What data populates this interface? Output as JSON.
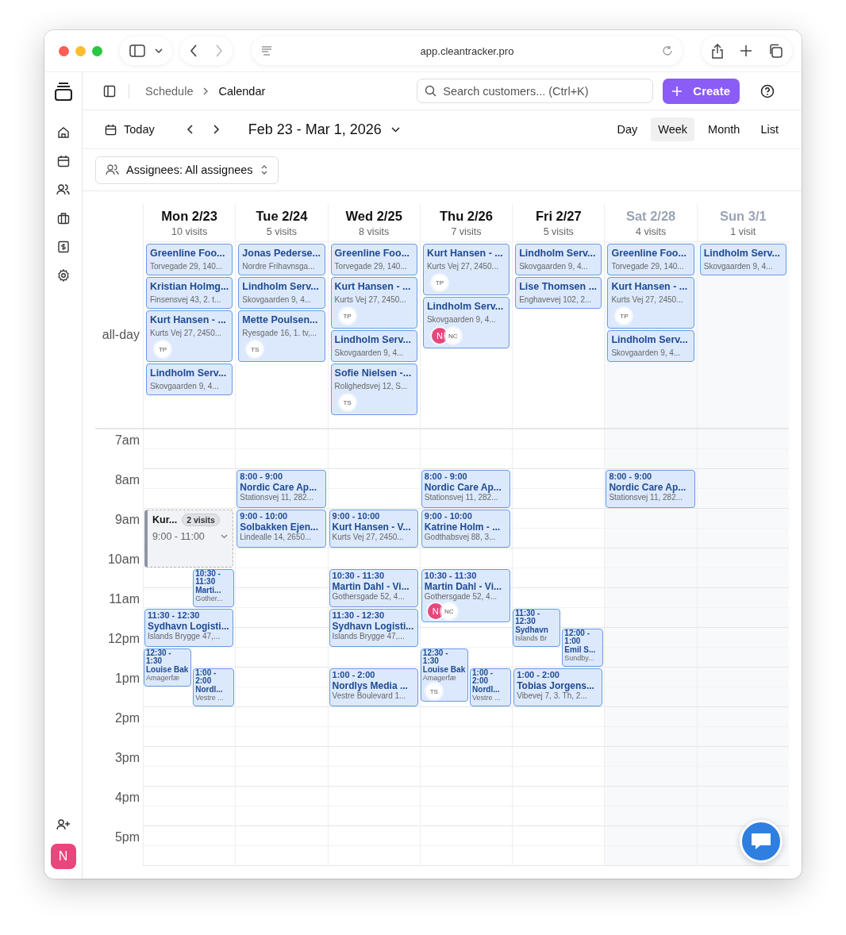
{
  "browser": {
    "url": "app.cleantracker.pro"
  },
  "sidebar": {
    "avatar": "N"
  },
  "header": {
    "breadcrumbs": [
      "Schedule",
      "Calendar"
    ],
    "search": {
      "placeholder": "Search customers... (Ctrl+K)"
    },
    "create_button": "Create"
  },
  "toolbar": {
    "today": "Today",
    "range": "Feb 23 - Mar 1, 2026",
    "views": [
      {
        "label": "Day",
        "selected": false
      },
      {
        "label": "Week",
        "selected": true
      },
      {
        "label": "Month",
        "selected": false
      },
      {
        "label": "List",
        "selected": false
      }
    ]
  },
  "filter": {
    "label": "Assignees: All assignees"
  },
  "calendar": {
    "all_day_label": "all-day",
    "hours": [
      "7am",
      "8am",
      "9am",
      "10am",
      "11am",
      "12pm",
      "1pm",
      "2pm",
      "3pm",
      "4pm",
      "5pm"
    ],
    "days": [
      {
        "label": "Mon 2/23",
        "count": "10 visits",
        "weekend": false,
        "all_day": [
          {
            "title": "Greenline Foo...",
            "address": "Torvegade 29, 140..."
          },
          {
            "title": "Kristian Holmg...",
            "address": "Finsensvej 43, 2. t..."
          },
          {
            "title": "Kurt Hansen - ...",
            "address": "Kurts Vej 27, 2450...",
            "avatars": [
              {
                "initials": "TP",
                "color": "#ffffff"
              }
            ]
          },
          {
            "title": "Lindholm Serv...",
            "address": "Skovgaarden 9, 4..."
          }
        ],
        "events": [
          {
            "kind": "group",
            "title": "Kur...",
            "count": "2 visits",
            "time": "9:00 - 11:00"
          },
          {
            "kind": "visit",
            "time": "10:30 - 11:30",
            "title": "Marti...",
            "address": "Gother..."
          },
          {
            "kind": "visit",
            "time": "11:30 - 12:30",
            "title": "Sydhavn Logisti...",
            "address": "Islands Brygge 47,..."
          },
          {
            "kind": "visit",
            "time": "12:30 - 1:30",
            "title": "Louise Bak",
            "address": "Amagerfæ"
          },
          {
            "kind": "visit",
            "time": "1:00 - 2:00",
            "title": "Nordl...",
            "address": "Vestre ..."
          }
        ]
      },
      {
        "label": "Tue 2/24",
        "count": "5 visits",
        "weekend": false,
        "all_day": [
          {
            "title": "Jonas Pederse...",
            "address": "Nordre Frihavnsga..."
          },
          {
            "title": "Lindholm Serv...",
            "address": "Skovgaarden 9, 4..."
          },
          {
            "title": "Mette Poulsen...",
            "address": "Ryesgade 16, 1. tv,...",
            "avatars": [
              {
                "initials": "TS",
                "color": "#ffffff"
              }
            ]
          }
        ],
        "events": [
          {
            "kind": "visit",
            "time": "8:00 - 9:00",
            "title": "Nordic Care Ap...",
            "address": "Stationsvej 11, 282..."
          },
          {
            "kind": "visit",
            "time": "9:00 - 10:00",
            "title": "Solbakken Ejen...",
            "address": "Lindealle 14, 2650..."
          }
        ]
      },
      {
        "label": "Wed 2/25",
        "count": "8 visits",
        "weekend": false,
        "all_day": [
          {
            "title": "Greenline Foo...",
            "address": "Torvegade 29, 140..."
          },
          {
            "title": "Kurt Hansen - ...",
            "address": "Kurts Vej 27, 2450...",
            "avatars": [
              {
                "initials": "TP",
                "color": "#ffffff"
              }
            ]
          },
          {
            "title": "Lindholm Serv...",
            "address": "Skovgaarden 9, 4..."
          },
          {
            "title": "Sofie Nielsen -...",
            "address": "Rolighedsvej 12, S...",
            "avatars": [
              {
                "initials": "TS",
                "color": "#ffffff"
              }
            ]
          }
        ],
        "events": [
          {
            "kind": "visit",
            "time": "9:00 - 10:00",
            "title": "Kurt Hansen - V...",
            "address": "Kurts Vej 27, 2450..."
          },
          {
            "kind": "visit",
            "time": "10:30 - 11:30",
            "title": "Martin Dahl - Vi...",
            "address": "Gothersgade 52, 4..."
          },
          {
            "kind": "visit",
            "time": "11:30 - 12:30",
            "title": "Sydhavn Logisti...",
            "address": "Islands Brygge 47,..."
          },
          {
            "kind": "visit",
            "time": "1:00 - 2:00",
            "title": "Nordlys Media ...",
            "address": "Vestre Boulevard 1..."
          }
        ]
      },
      {
        "label": "Thu 2/26",
        "count": "7 visits",
        "weekend": false,
        "all_day": [
          {
            "title": "Kurt Hansen - ...",
            "address": "Kurts Vej 27, 2450...",
            "avatars": [
              {
                "initials": "TP",
                "color": "#ffffff"
              }
            ]
          },
          {
            "title": "Lindholm Serv...",
            "address": "Skovgaarden 9, 4...",
            "avatars": [
              {
                "initials": "N",
                "color": "#e8467c"
              },
              {
                "initials": "NC",
                "color": "#ffffff"
              }
            ]
          }
        ],
        "events": [
          {
            "kind": "visit",
            "time": "8:00 - 9:00",
            "title": "Nordic Care Ap...",
            "address": "Stationsvej 11, 282..."
          },
          {
            "kind": "visit",
            "time": "9:00 - 10:00",
            "title": "Katrine Holm - ...",
            "address": "Godthabsvej 88, 3..."
          },
          {
            "kind": "visit",
            "time": "10:30 - 11:30",
            "title": "Martin Dahl - Vi...",
            "address": "Gothersgade 52, 4...",
            "avatars": [
              {
                "initials": "N",
                "color": "#e8467c"
              },
              {
                "initials": "NC",
                "color": "#ffffff"
              }
            ]
          },
          {
            "kind": "visit",
            "time": "12:30 - 1:30",
            "title": "Louise Bak",
            "address": "Amagerfæ",
            "avatars": [
              {
                "initials": "TS",
                "color": "#ffffff"
              }
            ]
          },
          {
            "kind": "visit",
            "time": "1:00 - 2:00",
            "title": "Nordl...",
            "address": "Vestre ..."
          }
        ]
      },
      {
        "label": "Fri 2/27",
        "count": "5 visits",
        "weekend": false,
        "all_day": [
          {
            "title": "Lindholm Serv...",
            "address": "Skovgaarden 9, 4..."
          },
          {
            "title": "Lise Thomsen ...",
            "address": "Enghavevej 102, 2..."
          }
        ],
        "events": [
          {
            "kind": "visit",
            "time": "11:30 - 12:30",
            "title": "Sydhavn",
            "address": "Islands Br"
          },
          {
            "kind": "visit",
            "time": "12:00 - 1:00",
            "title": "Emil S...",
            "address": "Sundby..."
          },
          {
            "kind": "visit",
            "time": "1:00 - 2:00",
            "title": "Tobias Jorgens...",
            "address": "Vibevej 7, 3. Th, 2..."
          }
        ]
      },
      {
        "label": "Sat 2/28",
        "count": "4 visits",
        "weekend": true,
        "all_day": [
          {
            "title": "Greenline Foo...",
            "address": "Torvegade 29, 140..."
          },
          {
            "title": "Kurt Hansen - ...",
            "address": "Kurts Vej 27, 2450...",
            "avatars": [
              {
                "initials": "TP",
                "color": "#ffffff"
              }
            ]
          },
          {
            "title": "Lindholm Serv...",
            "address": "Skovgaarden 9, 4..."
          }
        ],
        "events": [
          {
            "kind": "visit",
            "time": "8:00 - 9:00",
            "title": "Nordic Care Ap...",
            "address": "Stationsvej 11, 282..."
          }
        ]
      },
      {
        "label": "Sun 3/1",
        "count": "1 visit",
        "weekend": true,
        "all_day": [
          {
            "title": "Lindholm Serv...",
            "address": "Skovgaarden 9, 4..."
          }
        ]
      }
    ]
  }
}
